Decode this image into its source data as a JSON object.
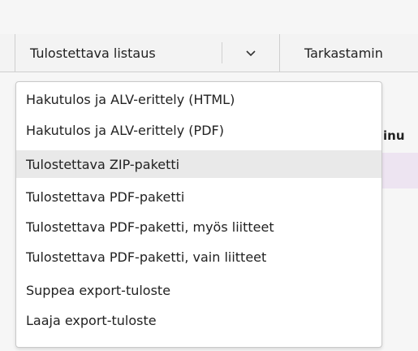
{
  "toolbar": {
    "print_listing_label": "Tulostettava listaus",
    "check_label": "Tarkastamin"
  },
  "background": {
    "header_fragment": "inu"
  },
  "menu": {
    "items": [
      "Hakutulos ja ALV-erittely (HTML)",
      "Hakutulos ja ALV-erittely (PDF)",
      "Tulostettava ZIP-paketti",
      "Tulostettava PDF-paketti",
      "Tulostettava PDF-paketti, myös liitteet",
      "Tulostettava PDF-paketti, vain liitteet",
      "Suppea export-tuloste",
      "Laaja export-tuloste"
    ],
    "highlighted_index": 2
  },
  "colors": {
    "selected_row": "#ede4f1",
    "hover_item": "#e9e9e9"
  }
}
